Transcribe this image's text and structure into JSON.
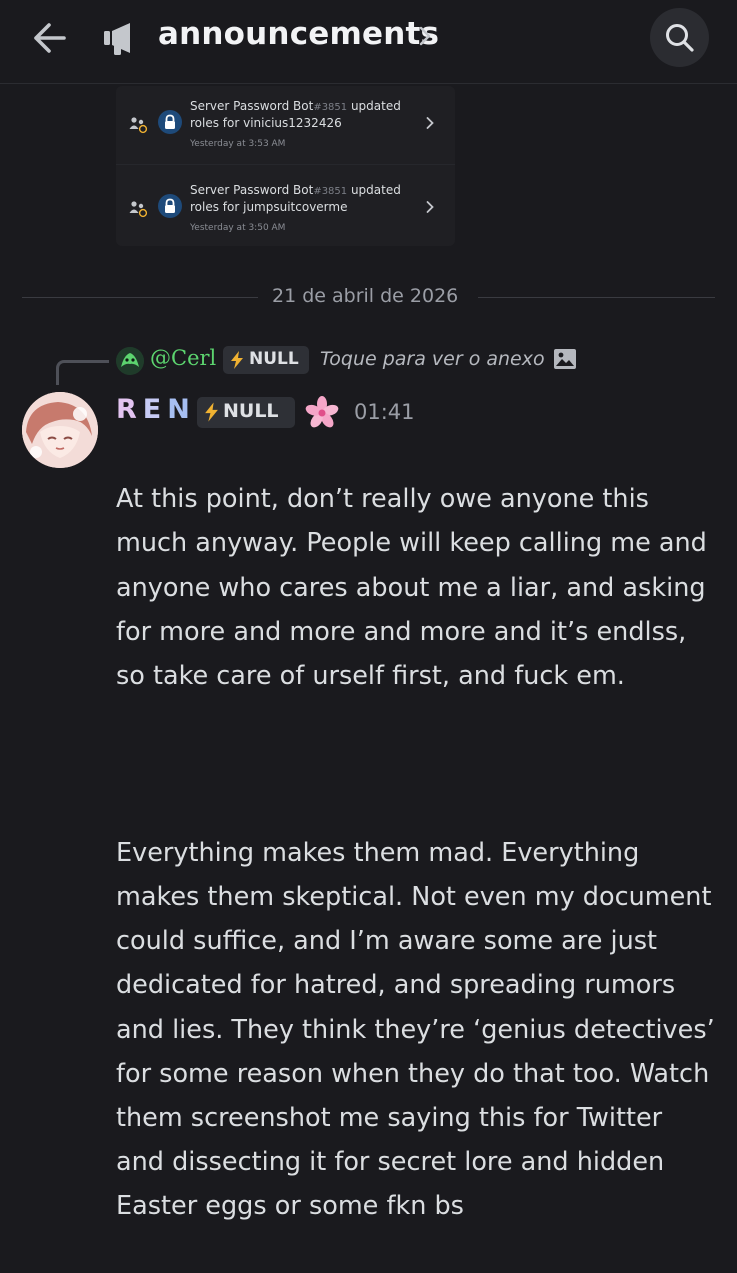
{
  "header": {
    "channel_name": "announcements",
    "back_icon": "arrow-left-icon",
    "channel_icon": "megaphone-icon",
    "search_icon": "search-icon"
  },
  "embeds": [
    {
      "bot_name": "Server Password Bot",
      "discriminator": "#3851",
      "action": " updated",
      "target": "roles for vinicius1232426",
      "time": "Yesterday at 3:53 AM"
    },
    {
      "bot_name": "Server Password Bot",
      "discriminator": "#3851",
      "action": " updated",
      "target": "roles for jumpsuitcoverme",
      "time": "Yesterday at 3:50 AM"
    }
  ],
  "date_divider": "21 de abril de 2026",
  "reply": {
    "author": "@Cerl",
    "tag": "NULL",
    "text": "Toque para ver o anexo"
  },
  "message": {
    "author_letters": [
      "R",
      "E",
      "N"
    ],
    "tag": "NULL",
    "time": "01:41",
    "paragraph1": "At this point, don’t really owe anyone this much anyway. People will keep calling me and anyone who cares about me a liar, and asking for more and more and more and it’s endlss, so take care of urself first, and fuck em.",
    "paragraph2": "Everything makes them mad. Everything makes them skeptical. Not even my document could  suffice, and I’m aware some are just dedicated for hatred, and spreading rumors and lies. They think they’re ‘genius detectives’ for some reason when they do that too. Watch them screenshot me saying this for Twitter and dissecting it for secret lore and hidden Easter eggs or some fkn bs"
  },
  "colors": {
    "background": "#1a1a1e",
    "reply_author": "#5cd46f",
    "author_gradient_start": "#e3c4f1",
    "author_gradient_end": "#a7bff2"
  }
}
